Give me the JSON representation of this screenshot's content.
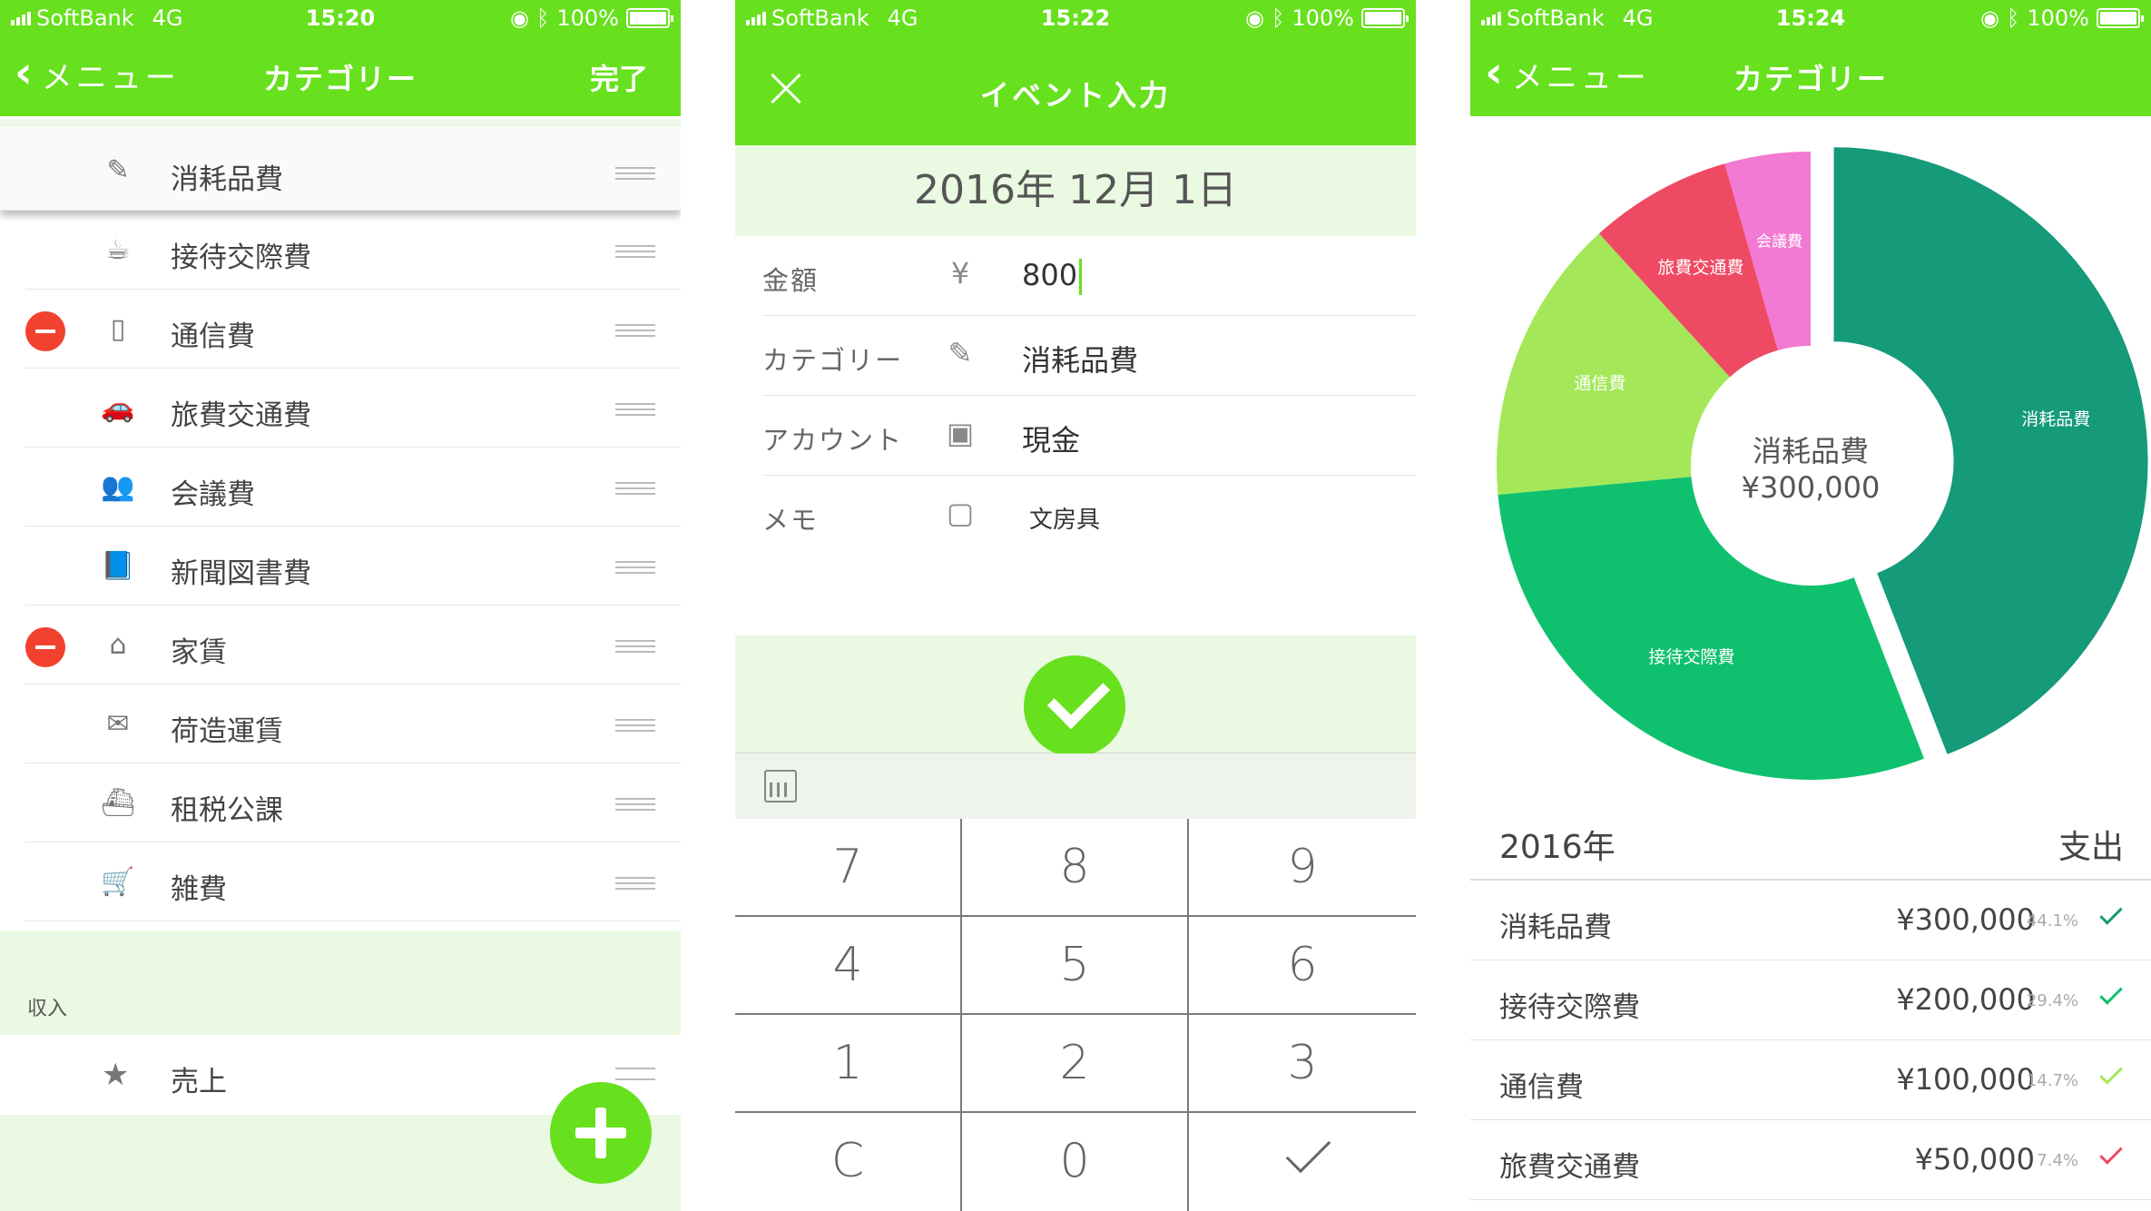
{
  "status_bars": [
    {
      "carrier": "SoftBank",
      "network": "4G",
      "time": "15:20",
      "battery": "100%"
    },
    {
      "carrier": "SoftBank",
      "network": "4G",
      "time": "15:22",
      "battery": "100%"
    },
    {
      "carrier": "SoftBank",
      "network": "4G",
      "time": "15:24",
      "battery": "100%"
    }
  ],
  "colors": {
    "accent": "#67e01d",
    "light_band": "#eaf9e1",
    "delete": "#f2412e"
  },
  "screen1": {
    "nav": {
      "back_label": "メニュー",
      "title": "カテゴリー",
      "done_label": "完了"
    },
    "categories": [
      {
        "label": "消耗品費",
        "icon": "pencil-icon",
        "glyph": "✎",
        "deletable": false,
        "dragging": true
      },
      {
        "label": "接待交際費",
        "icon": "tea-cup-icon",
        "glyph": "☕",
        "deletable": false
      },
      {
        "label": "通信費",
        "icon": "phone-icon",
        "glyph": "▯",
        "deletable": true
      },
      {
        "label": "旅費交通費",
        "icon": "car-icon",
        "glyph": "🚗",
        "deletable": false
      },
      {
        "label": "会議費",
        "icon": "group-icon",
        "glyph": "👥",
        "deletable": false
      },
      {
        "label": "新聞図書費",
        "icon": "book-icon",
        "glyph": "📘",
        "deletable": false
      },
      {
        "label": "家賃",
        "icon": "home-icon",
        "glyph": "⌂",
        "deletable": true
      },
      {
        "label": "荷造運賃",
        "icon": "envelope-icon",
        "glyph": "✉",
        "deletable": false
      },
      {
        "label": "租税公課",
        "icon": "ship-icon",
        "glyph": "⛴",
        "deletable": false
      },
      {
        "label": "雑費",
        "icon": "cart-icon",
        "glyph": "🛒",
        "deletable": false
      }
    ],
    "income_header": "収入",
    "income_items": [
      {
        "label": "売上",
        "icon": "star-icon",
        "glyph": "★"
      }
    ]
  },
  "screen2": {
    "title": "イベント入力",
    "date": "2016年 12月 1日",
    "fields": [
      {
        "label": "金額",
        "icon": "yen-icon",
        "glyph": "¥",
        "value": "800"
      },
      {
        "label": "カテゴリー",
        "icon": "pencil-icon",
        "glyph": "✎",
        "value": "消耗品費"
      },
      {
        "label": "アカウント",
        "icon": "banknote-icon",
        "glyph": "▣",
        "value": "現金"
      },
      {
        "label": "メモ",
        "icon": "note-icon",
        "glyph": "▢",
        "value": "文房具"
      }
    ],
    "keys": [
      "7",
      "8",
      "9",
      "4",
      "5",
      "6",
      "1",
      "2",
      "3",
      "C",
      "0",
      ""
    ]
  },
  "screen3": {
    "nav": {
      "back_label": "メニュー",
      "title": "カテゴリー"
    },
    "center_label": "消耗品費",
    "center_value": "¥300,000",
    "year": "2016年",
    "type_label": "支出",
    "rows": [
      {
        "name": "消耗品費",
        "amount": "¥300,000",
        "pct": "44.1%",
        "check_color": "#159a7a"
      },
      {
        "name": "接待交際費",
        "amount": "¥200,000",
        "pct": "29.4%",
        "check_color": "#0fc16e"
      },
      {
        "name": "通信費",
        "amount": "¥100,000",
        "pct": "14.7%",
        "check_color": "#a4e85a"
      },
      {
        "name": "旅費交通費",
        "amount": "¥50,000",
        "pct": "7.4%",
        "check_color": "#ef4a63"
      }
    ]
  },
  "chart_data": {
    "type": "pie",
    "categories": [
      "消耗品費",
      "接待交際費",
      "通信費",
      "旅費交通費",
      "会議費"
    ],
    "values": [
      300000,
      200000,
      100000,
      50000,
      30000
    ],
    "colors": [
      "#159a7a",
      "#0fc16e",
      "#a4e85a",
      "#ef4a63",
      "#f27ad2"
    ],
    "donut": true,
    "exploded": "消耗品費"
  }
}
